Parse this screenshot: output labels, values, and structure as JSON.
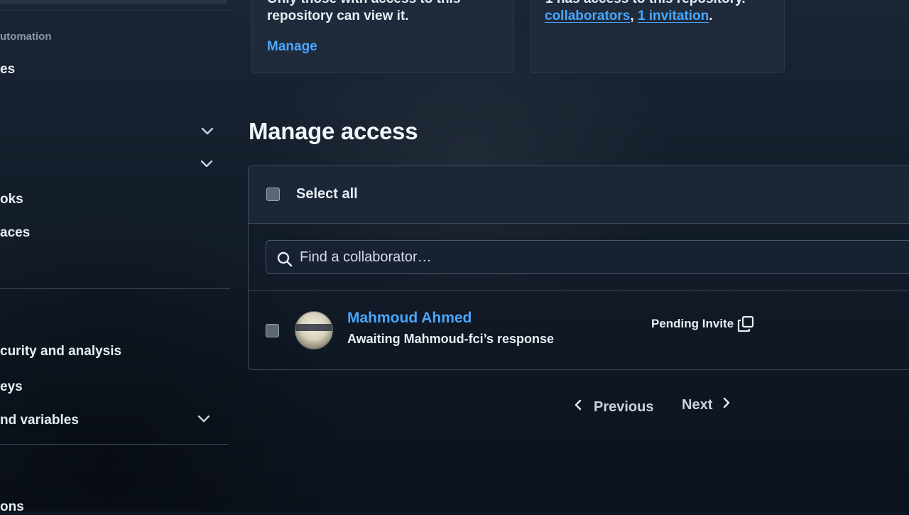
{
  "sidebar": {
    "group_label": "utomation",
    "items": [
      {
        "label": "es"
      },
      {
        "label": "oks"
      },
      {
        "label": "aces"
      },
      {
        "label": "curity and analysis"
      },
      {
        "label": "eys"
      },
      {
        "label": "nd variables"
      },
      {
        "label": "ons"
      }
    ]
  },
  "cards": {
    "visibility": {
      "text_line1": "Only those with access to this",
      "text_line2": "repository can view it.",
      "link": "Manage"
    },
    "access": {
      "text_line1": "1 has access to this repository.",
      "collaborators_link": "collaborators",
      "separator": ",",
      "invitation_link": "1 invitation",
      "end": "."
    }
  },
  "manage_access": {
    "title": "Manage access",
    "select_all_label": "Select all",
    "search": {
      "placeholder": "Find a collaborator…",
      "value": ""
    },
    "collaborators": [
      {
        "name": "Mahmoud Ahmed",
        "status": "Awaiting Mahmoud-fci’s response",
        "role_label": "Pending Invite"
      }
    ]
  },
  "pagination": {
    "previous_label": "Previous",
    "next_label": "Next"
  },
  "icons": {
    "search": "search-icon",
    "copy": "copy-icon",
    "chevron_left": "chevron-left-icon",
    "chevron_right": "chevron-right-icon",
    "chevron_down": "chevron-down-icon"
  },
  "colors": {
    "link": "#4aa7ff",
    "background": "#0e1622"
  }
}
